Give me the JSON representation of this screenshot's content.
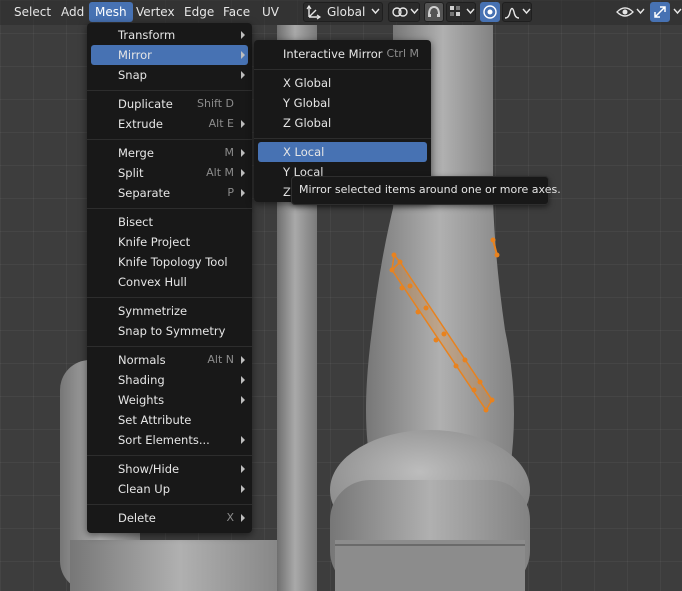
{
  "header": {
    "menus": [
      "Select",
      "Add",
      "Mesh",
      "Vertex",
      "Edge",
      "Face",
      "UV"
    ],
    "active_menu": "Mesh",
    "orientation": "Global",
    "icons": [
      "orientation-icon",
      "pivot-icon",
      "snap-icon",
      "snap-target-icon",
      "proportional-edit-icon",
      "falloff-icon",
      "viewport-overlay-icon",
      "gizmo-icon"
    ]
  },
  "mesh_menu": {
    "items": [
      {
        "label": "Transform",
        "shortcut": "",
        "submenu": true
      },
      {
        "label": "Mirror",
        "shortcut": "",
        "submenu": true,
        "highlighted": true
      },
      {
        "label": "Snap",
        "shortcut": "",
        "submenu": true
      },
      {
        "label": "Duplicate",
        "shortcut": "Shift D",
        "submenu": false
      },
      {
        "label": "Extrude",
        "shortcut": "Alt E",
        "submenu": true
      },
      {
        "label": "Merge",
        "shortcut": "M",
        "submenu": true
      },
      {
        "label": "Split",
        "shortcut": "Alt M",
        "submenu": true
      },
      {
        "label": "Separate",
        "shortcut": "P",
        "submenu": true
      },
      {
        "label": "Bisect",
        "shortcut": "",
        "submenu": false
      },
      {
        "label": "Knife Project",
        "shortcut": "",
        "submenu": false
      },
      {
        "label": "Knife Topology Tool",
        "shortcut": "",
        "submenu": false
      },
      {
        "label": "Convex Hull",
        "shortcut": "",
        "submenu": false
      },
      {
        "label": "Symmetrize",
        "shortcut": "",
        "submenu": false
      },
      {
        "label": "Snap to Symmetry",
        "shortcut": "",
        "submenu": false
      },
      {
        "label": "Normals",
        "shortcut": "Alt N",
        "submenu": true
      },
      {
        "label": "Shading",
        "shortcut": "",
        "submenu": true
      },
      {
        "label": "Weights",
        "shortcut": "",
        "submenu": true
      },
      {
        "label": "Set Attribute",
        "shortcut": "",
        "submenu": false
      },
      {
        "label": "Sort Elements...",
        "shortcut": "",
        "submenu": true
      },
      {
        "label": "Show/Hide",
        "shortcut": "",
        "submenu": true
      },
      {
        "label": "Clean Up",
        "shortcut": "",
        "submenu": true
      },
      {
        "label": "Delete",
        "shortcut": "X",
        "submenu": true
      }
    ]
  },
  "mirror_submenu": {
    "items": [
      {
        "label": "Interactive Mirror",
        "shortcut": "Ctrl M"
      },
      {
        "label": "X Global",
        "shortcut": ""
      },
      {
        "label": "Y Global",
        "shortcut": ""
      },
      {
        "label": "Z Global",
        "shortcut": ""
      },
      {
        "label": "X Local",
        "shortcut": "",
        "highlighted": true
      },
      {
        "label": "Y Local",
        "shortcut": ""
      },
      {
        "label": "Z",
        "shortcut": ""
      }
    ]
  },
  "tooltip": {
    "text": "Mirror selected items around one or more axes."
  },
  "colors": {
    "accent": "#4772b3",
    "menu_bg": "#181818",
    "selection": "#e8821e",
    "mesh": "#9a9a9a"
  }
}
